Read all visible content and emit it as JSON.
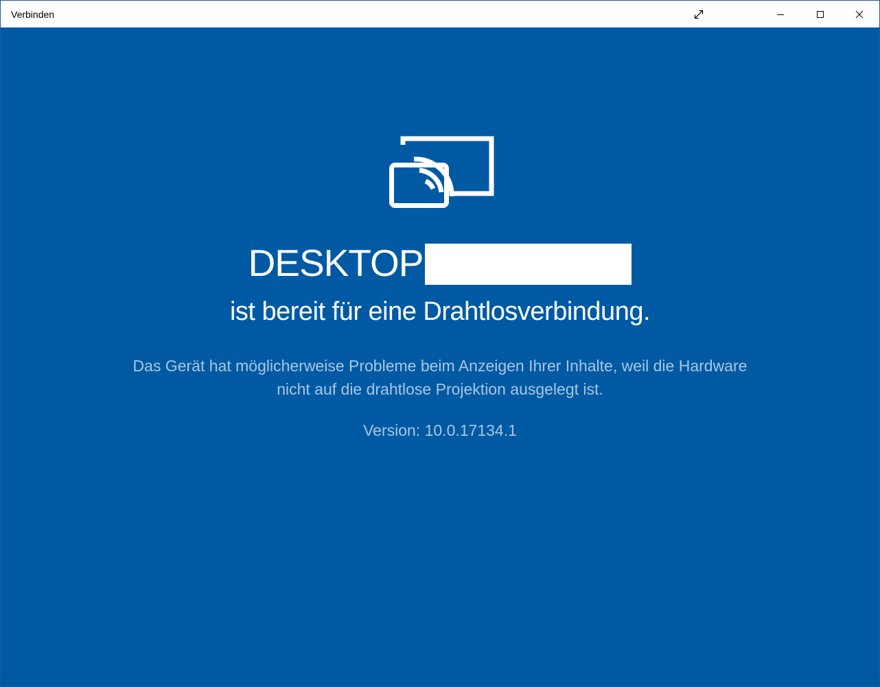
{
  "window": {
    "title": "Verbinden",
    "accent_color": "#005aa3"
  },
  "titlebar": {
    "buttons": {
      "fullscreen_icon": "fullscreen-expand-icon",
      "minimize_icon": "minimize-icon",
      "maximize_icon": "maximize-icon",
      "close_icon": "close-icon"
    }
  },
  "main": {
    "icon": "wireless-projection-icon",
    "device_name": "DESKTOP",
    "status": "ist bereit für eine Drahtlosverbindung.",
    "warning": "Das Gerät hat möglicherweise Probleme beim Anzeigen Ihrer Inhalte, weil die Hardware nicht auf die drahtlose Projektion ausgelegt ist.",
    "version": "Version: 10.0.17134.1"
  }
}
